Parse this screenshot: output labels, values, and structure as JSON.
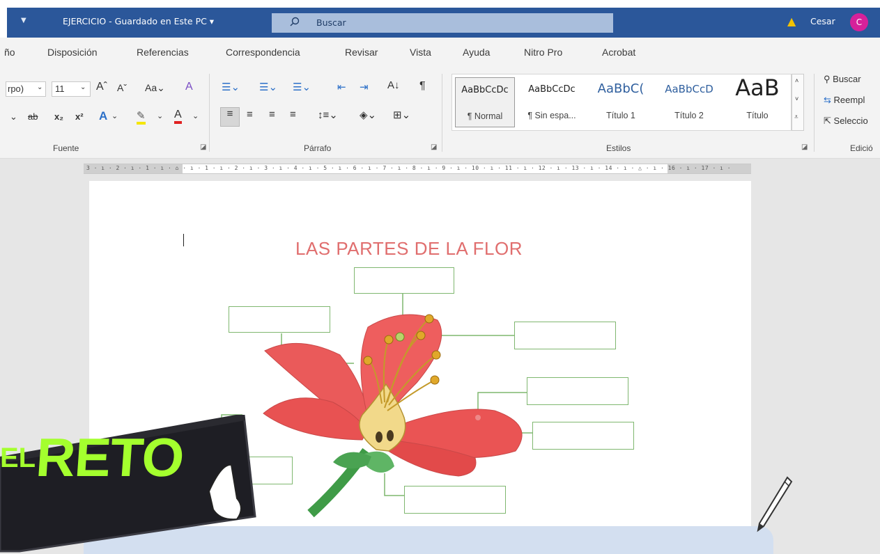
{
  "titlebar": {
    "document_title": "EJERCICIO - Guardado en Este PC ▾",
    "search_placeholder": "Buscar",
    "user_name": "Cesar",
    "avatar_initial": "C"
  },
  "tabs": [
    "ño",
    "Disposición",
    "Referencias",
    "Correspondencia",
    "Revisar",
    "Vista",
    "Ayuda",
    "Nitro Pro",
    "Acrobat"
  ],
  "ribbon": {
    "font_name": "rpo)",
    "font_size": "11",
    "groups": {
      "fuente": "Fuente",
      "parrafo": "Párrafo",
      "estilos": "Estilos",
      "edicion": "Edició"
    },
    "styles": [
      {
        "sample": "AaBbCcDc",
        "name": "¶ Normal"
      },
      {
        "sample": "AaBbCcDc",
        "name": "¶ Sin espa..."
      },
      {
        "sample": "AaBbC(",
        "name": "Título 1"
      },
      {
        "sample": "AaBbCcD",
        "name": "Título 2"
      },
      {
        "sample": "AaB",
        "name": "Título"
      }
    ],
    "editing": {
      "find": "Buscar",
      "replace": "Reempl",
      "select": "Seleccio"
    }
  },
  "ruler": {
    "text": "3 · ı · 2 · ı · 1 · ı · ⌂ · ı · 1 · ı · 2 · ı · 3 · ı · 4 · ı · 5 · ı · 6 · ı · 7 · ı · 8 · ı · 9 · ı · 10 · ı · 11 · ı · 12 · ı · 13 · ı · 14 · ı · △ · ı · 16 · ı · 17 · ı ·"
  },
  "document": {
    "title": "LAS PARTES DE LA FLOR"
  },
  "badge": {
    "prefix": "EL",
    "word": "RETO"
  },
  "colors": {
    "titlebar": "#2b579a",
    "accent_title": "#e06e6e",
    "label_border": "#7fb76f",
    "badge_text": "#a4ff2e",
    "avatar": "#d6219a"
  }
}
